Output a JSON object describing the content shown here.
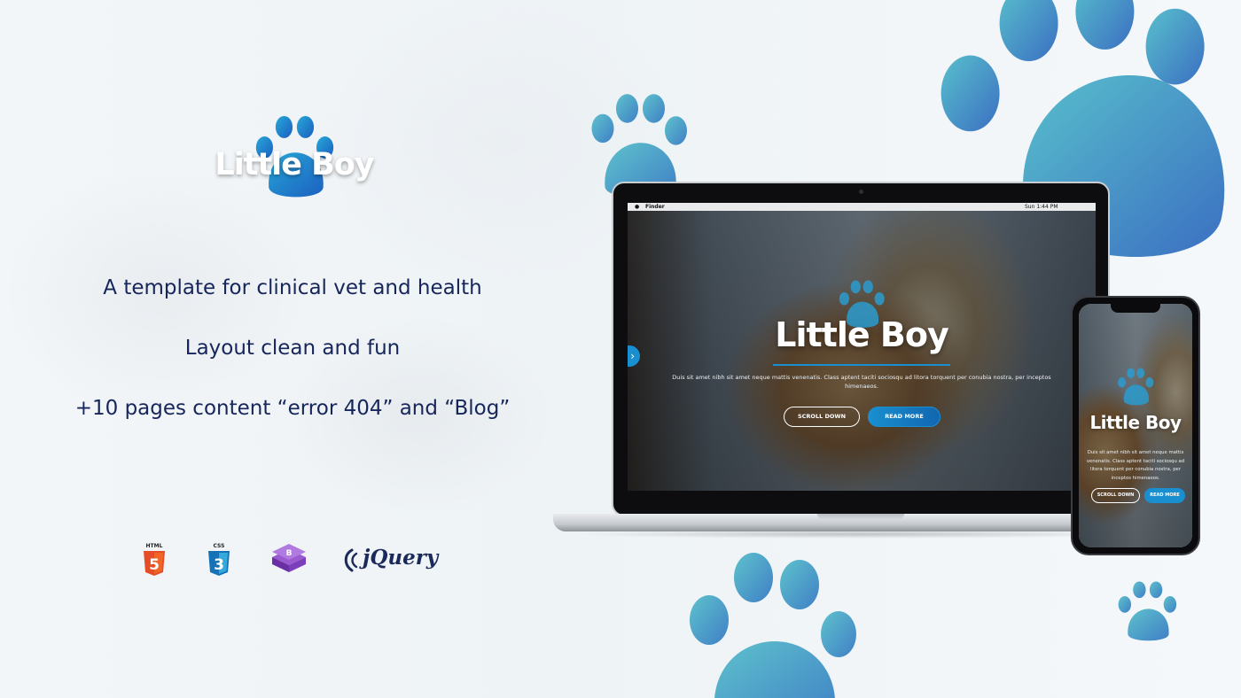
{
  "brand": {
    "logo_text": "Little Boy",
    "paw_colors": [
      "#2a9fd0",
      "#1a79c8",
      "#33b2c9"
    ]
  },
  "left": {
    "taglines": [
      "A template for clinical vet and health",
      "Layout clean and fun",
      "+10 pages content “error 404” and “Blog”"
    ],
    "tech": [
      {
        "label": "HTML",
        "icon": "html5-icon",
        "color": "#e44d26"
      },
      {
        "label": "CSS",
        "icon": "css3-icon",
        "color": "#1572b6"
      },
      {
        "label": "",
        "icon": "bootstrap-icon",
        "color": "#7a3eb5"
      },
      {
        "label": "jQuery",
        "icon": "jquery-icon",
        "color": "#1b2a5a"
      }
    ]
  },
  "laptop": {
    "menubar": {
      "app": "Finder",
      "clock": "Sun 1:44 PM"
    },
    "hero": {
      "title": "Little Boy",
      "description": "Duis sit amet nibh sit amet neque mattis venenatis. Class aptent taciti sociosqu ad litora torquent per conubia nostra, per inceptos himenaeos.",
      "scroll_label": "SCROLL DOWN",
      "read_label": "READ MORE"
    }
  },
  "phone": {
    "hero": {
      "title": "Little Boy",
      "description": "Duis sit amet nibh sit amet neque mattis venenatis. Class aptent taciti sociosqu ad litora torquent per conubia nostra, per inceptos himenaeos.",
      "scroll_label": "SCROLL DOWN",
      "read_label": "READ MORE"
    }
  },
  "colors": {
    "accent": "#1a8fd0",
    "text_navy": "#16265a",
    "paw_light": "#5fb7cc",
    "paw_blue": "#3f86c9"
  }
}
